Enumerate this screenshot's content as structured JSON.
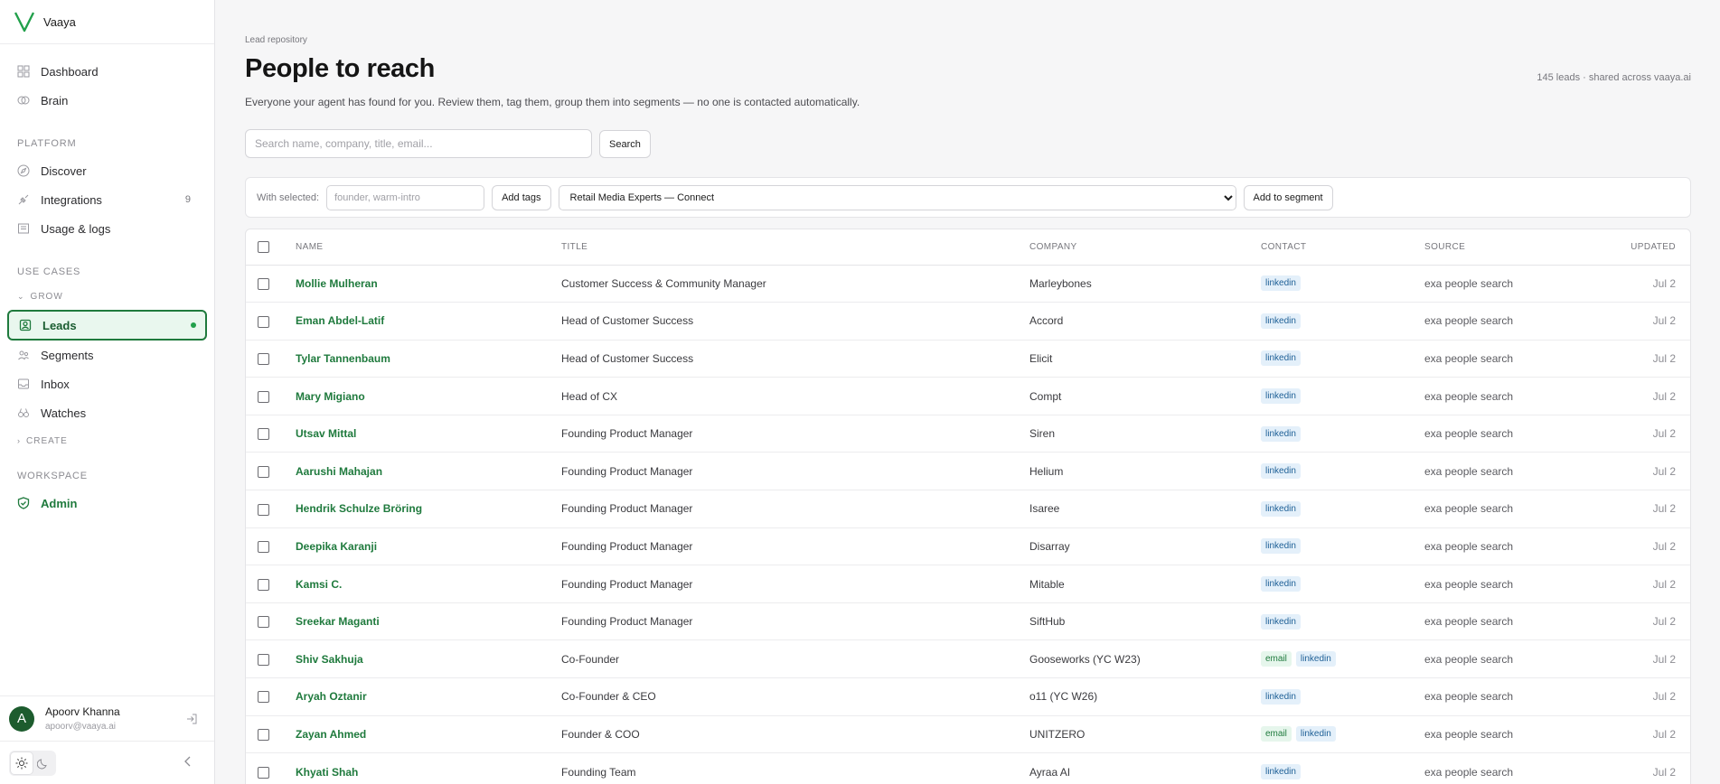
{
  "brand": {
    "name": "Vaaya",
    "color": "#22a04b"
  },
  "nav": {
    "top": [
      {
        "label": "Dashboard",
        "icon": "grid-icon"
      },
      {
        "label": "Brain",
        "icon": "brain-icon"
      }
    ],
    "platform_label": "PLATFORM",
    "platform": [
      {
        "label": "Discover",
        "icon": "compass-icon"
      },
      {
        "label": "Integrations",
        "icon": "plug-icon",
        "count": "9"
      },
      {
        "label": "Usage & logs",
        "icon": "logs-icon"
      }
    ],
    "use_cases_label": "USE CASES",
    "grow_label": "GROW",
    "grow": [
      {
        "label": "Leads",
        "icon": "leads-icon",
        "active": true
      },
      {
        "label": "Segments",
        "icon": "segments-icon"
      },
      {
        "label": "Inbox",
        "icon": "inbox-icon"
      },
      {
        "label": "Watches",
        "icon": "binoculars-icon"
      }
    ],
    "create_label": "CREATE",
    "workspace_label": "WORKSPACE",
    "workspace": [
      {
        "label": "Admin",
        "icon": "shield-check-icon"
      }
    ]
  },
  "user": {
    "initial": "A",
    "name": "Apoorv Khanna",
    "email": "apoorv@vaaya.ai"
  },
  "page": {
    "breadcrumb": "Lead repository",
    "title": "People to reach",
    "subtitle": "Everyone your agent has found for you. Review them, tag them, group them into segments — no one is contacted automatically.",
    "meta": "145 leads · shared across vaaya.ai"
  },
  "search": {
    "placeholder": "Search name, company, title, email...",
    "button": "Search"
  },
  "bulk": {
    "label": "With selected:",
    "tag_placeholder": "founder, warm-intro",
    "add_tags": "Add tags",
    "segment_selected": "Retail Media Experts — Connect",
    "add_segment": "Add to segment"
  },
  "table": {
    "columns": [
      "NAME",
      "TITLE",
      "COMPANY",
      "CONTACT",
      "SOURCE",
      "UPDATED"
    ],
    "rows": [
      {
        "name": "Mollie Mulheran",
        "title": "Customer Success & Community Manager",
        "company": "Marleybones",
        "contact": [
          "linkedin"
        ],
        "source": "exa people search",
        "updated": "Jul 2"
      },
      {
        "name": "Eman Abdel-Latif",
        "title": "Head of Customer Success",
        "company": "Accord",
        "contact": [
          "linkedin"
        ],
        "source": "exa people search",
        "updated": "Jul 2"
      },
      {
        "name": "Tylar Tannenbaum",
        "title": "Head of Customer Success",
        "company": "Elicit",
        "contact": [
          "linkedin"
        ],
        "source": "exa people search",
        "updated": "Jul 2"
      },
      {
        "name": "Mary Migiano",
        "title": "Head of CX",
        "company": "Compt",
        "contact": [
          "linkedin"
        ],
        "source": "exa people search",
        "updated": "Jul 2"
      },
      {
        "name": "Utsav Mittal",
        "title": "Founding Product Manager",
        "company": "Siren",
        "contact": [
          "linkedin"
        ],
        "source": "exa people search",
        "updated": "Jul 2"
      },
      {
        "name": "Aarushi Mahajan",
        "title": "Founding Product Manager",
        "company": "Helium",
        "contact": [
          "linkedin"
        ],
        "source": "exa people search",
        "updated": "Jul 2"
      },
      {
        "name": "Hendrik Schulze Bröring",
        "title": "Founding Product Manager",
        "company": "Isaree",
        "contact": [
          "linkedin"
        ],
        "source": "exa people search",
        "updated": "Jul 2"
      },
      {
        "name": "Deepika Karanji",
        "title": "Founding Product Manager",
        "company": "Disarray",
        "contact": [
          "linkedin"
        ],
        "source": "exa people search",
        "updated": "Jul 2"
      },
      {
        "name": "Kamsi C.",
        "title": "Founding Product Manager",
        "company": "Mitable",
        "contact": [
          "linkedin"
        ],
        "source": "exa people search",
        "updated": "Jul 2"
      },
      {
        "name": "Sreekar Maganti",
        "title": "Founding Product Manager",
        "company": "SiftHub",
        "contact": [
          "linkedin"
        ],
        "source": "exa people search",
        "updated": "Jul 2"
      },
      {
        "name": "Shiv Sakhuja",
        "title": "Co-Founder",
        "company": "Gooseworks (YC W23)",
        "contact": [
          "email",
          "linkedin"
        ],
        "source": "exa people search",
        "updated": "Jul 2"
      },
      {
        "name": "Aryah Oztanir",
        "title": "Co-Founder & CEO",
        "company": "o11 (YC W26)",
        "contact": [
          "linkedin"
        ],
        "source": "exa people search",
        "updated": "Jul 2"
      },
      {
        "name": "Zayan Ahmed",
        "title": "Founder & COO",
        "company": "UNITZERO",
        "contact": [
          "email",
          "linkedin"
        ],
        "source": "exa people search",
        "updated": "Jul 2"
      },
      {
        "name": "Khyati Shah",
        "title": "Founding Team",
        "company": "Ayraa AI",
        "contact": [
          "linkedin"
        ],
        "source": "exa people search",
        "updated": "Jul 2"
      }
    ]
  }
}
